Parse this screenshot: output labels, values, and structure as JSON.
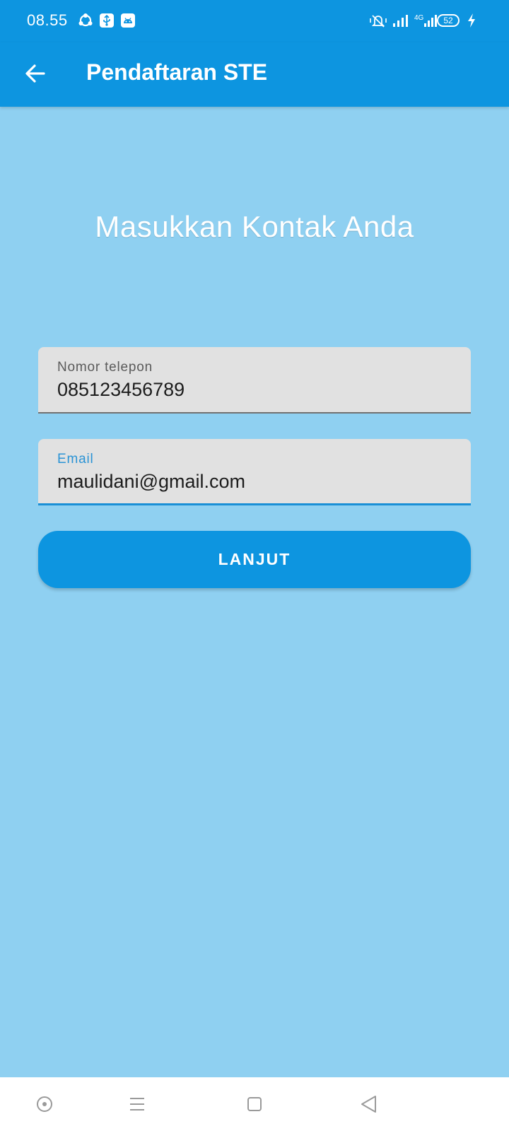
{
  "status_bar": {
    "time": "08.55",
    "battery_level": "52",
    "network": "4G",
    "left_icons": [
      "share-icon",
      "usb-icon",
      "android-icon"
    ],
    "right_icons": [
      "vibrate-silent-icon",
      "signal-icon",
      "4g-signal-icon",
      "battery-icon",
      "charging-icon"
    ]
  },
  "app_bar": {
    "title": "Pendaftaran STE",
    "back_icon": "arrow-left-icon"
  },
  "heading": "Masukkan Kontak Anda",
  "form": {
    "phone": {
      "label": "Nomor telepon",
      "value": "085123456789"
    },
    "email": {
      "label": "Email",
      "value": "maulidani@gmail.com"
    },
    "submit_label": "LANJUT"
  },
  "nav_bar": {
    "icons": [
      "assistant-icon",
      "menu-icon",
      "home-icon",
      "back-triangle-icon"
    ]
  },
  "colors": {
    "primary": "#0d95e0",
    "background": "#8fd0f1",
    "field_background": "#e1e1e1",
    "focus_accent": "#2a93d5"
  }
}
